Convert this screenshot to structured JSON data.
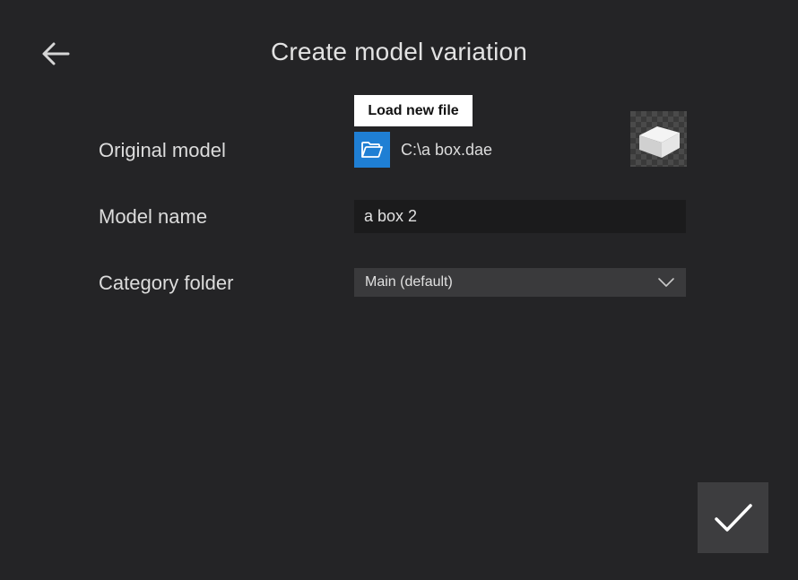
{
  "header": {
    "title": "Create model variation",
    "back_icon": "arrow-left-icon"
  },
  "form": {
    "original_model": {
      "label": "Original model",
      "tooltip": "Load new file",
      "folder_icon": "folder-open-icon",
      "file_path": "C:\\a box.dae",
      "thumbnail": "box-model-thumbnail"
    },
    "model_name": {
      "label": "Model name",
      "value": "a box 2"
    },
    "category_folder": {
      "label": "Category folder",
      "selected": "Main (default)",
      "chevron_icon": "chevron-down-icon"
    }
  },
  "actions": {
    "confirm_icon": "checkmark-icon"
  },
  "colors": {
    "background": "#242426",
    "accent": "#1f7fd4",
    "input_background": "#1b1b1c",
    "dropdown_background": "#3a3a3c",
    "confirm_background": "#3d3d3f"
  }
}
